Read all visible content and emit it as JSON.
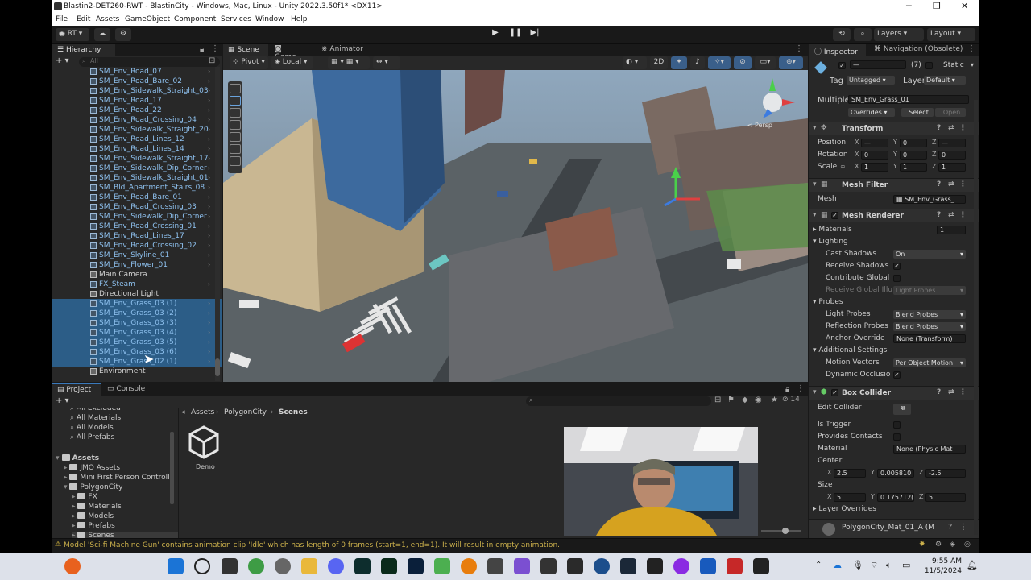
{
  "titlebar": {
    "title": "Blastin2-DET260-RWT - BlastinCity - Windows, Mac, Linux - Unity 2022.3.50f1* <DX11>"
  },
  "menu": [
    "File",
    "Edit",
    "Assets",
    "GameObject",
    "Component",
    "Services",
    "Window",
    "Help"
  ],
  "toolbar": {
    "account": "RT",
    "layers": "Layers",
    "layout": "Layout"
  },
  "hierarchy": {
    "tab": "Hierarchy",
    "search_placeholder": "All",
    "items": [
      {
        "label": "SM_Env_Road_07",
        "kind": "blue",
        "sel": false
      },
      {
        "label": "SM_Env_Road_Bare_02",
        "kind": "blue",
        "sel": false
      },
      {
        "label": "SM_Env_Sidewalk_Straight_03",
        "kind": "blue",
        "sel": false
      },
      {
        "label": "SM_Env_Road_17",
        "kind": "blue",
        "sel": false
      },
      {
        "label": "SM_Env_Road_22",
        "kind": "blue",
        "sel": false
      },
      {
        "label": "SM_Env_Road_Crossing_04",
        "kind": "blue",
        "sel": false
      },
      {
        "label": "SM_Env_Sidewalk_Straight_20",
        "kind": "blue",
        "sel": false
      },
      {
        "label": "SM_Env_Road_Lines_12",
        "kind": "blue",
        "sel": false
      },
      {
        "label": "SM_Env_Road_Lines_14",
        "kind": "blue",
        "sel": false
      },
      {
        "label": "SM_Env_Sidewalk_Straight_17",
        "kind": "blue",
        "sel": false
      },
      {
        "label": "SM_Env_Sidewalk_Dip_Corner",
        "kind": "blue",
        "sel": false
      },
      {
        "label": "SM_Env_Sidewalk_Straight_01",
        "kind": "blue",
        "sel": false
      },
      {
        "label": "SM_Bld_Apartment_Stairs_08",
        "kind": "blue",
        "sel": false
      },
      {
        "label": "SM_Env_Road_Bare_01",
        "kind": "blue",
        "sel": false
      },
      {
        "label": "SM_Env_Road_Crossing_03",
        "kind": "blue",
        "sel": false
      },
      {
        "label": "SM_Env_Sidewalk_Dip_Corner",
        "kind": "blue",
        "sel": false
      },
      {
        "label": "SM_Env_Road_Crossing_01",
        "kind": "blue",
        "sel": false
      },
      {
        "label": "SM_Env_Road_Lines_17",
        "kind": "blue",
        "sel": false
      },
      {
        "label": "SM_Env_Road_Crossing_02",
        "kind": "blue",
        "sel": false
      },
      {
        "label": "SM_Env_Skyline_01",
        "kind": "blue",
        "sel": false
      },
      {
        "label": "SM_Env_Flower_01",
        "kind": "blue",
        "sel": false
      },
      {
        "label": "Main Camera",
        "kind": "plain",
        "sel": false
      },
      {
        "label": "FX_Steam",
        "kind": "blue",
        "sel": false
      },
      {
        "label": "Directional Light",
        "kind": "plain",
        "sel": false
      },
      {
        "label": "SM_Env_Grass_03 (1)",
        "kind": "blue",
        "sel": true
      },
      {
        "label": "SM_Env_Grass_03 (2)",
        "kind": "blue",
        "sel": true
      },
      {
        "label": "SM_Env_Grass_03 (3)",
        "kind": "blue",
        "sel": true
      },
      {
        "label": "SM_Env_Grass_03 (4)",
        "kind": "blue",
        "sel": true
      },
      {
        "label": "SM_Env_Grass_03 (5)",
        "kind": "blue",
        "sel": true
      },
      {
        "label": "SM_Env_Grass_03 (6)",
        "kind": "blue",
        "sel": true
      },
      {
        "label": "SM_Env_Grass_02 (1)",
        "kind": "blue",
        "sel": true
      },
      {
        "label": "Environment",
        "kind": "plain",
        "sel": false
      }
    ]
  },
  "scene": {
    "tabs": [
      "Scene",
      "Game",
      "Animator"
    ],
    "pivot": "Pivot",
    "local": "Local",
    "mode_2d": "2D",
    "persp": "< Persp"
  },
  "inspector": {
    "tabs": [
      "Inspector",
      "Navigation (Obsolete)"
    ],
    "object_count": "(7)",
    "static": "Static",
    "tag_label": "Tag",
    "tag": "Untagged",
    "layer_label": "Layer",
    "layer": "Default",
    "multiple_label": "Multiple",
    "multiple_value": "SM_Env_Grass_01",
    "overrides": "Overrides",
    "select": "Select",
    "open": "Open",
    "transform": {
      "title": "Transform",
      "position": {
        "label": "Position",
        "x": "—",
        "y": "0",
        "z": "—"
      },
      "rotation": {
        "label": "Rotation",
        "x": "0",
        "y": "0",
        "z": "0"
      },
      "scale": {
        "label": "Scale",
        "x": "1",
        "y": "1",
        "z": "1"
      }
    },
    "mesh_filter": {
      "title": "Mesh Filter",
      "mesh_label": "Mesh",
      "mesh": "SM_Env_Grass_"
    },
    "mesh_renderer": {
      "title": "Mesh Renderer",
      "materials": "Materials",
      "materials_count": "1",
      "lighting": "Lighting",
      "cast_shadows": "Cast Shadows",
      "cast_shadows_val": "On",
      "receive_shadows": "Receive Shadows",
      "contribute_gi": "Contribute Global",
      "receive_gi": "Receive Global Illu",
      "receive_gi_val": "Light Probes",
      "probes": "Probes",
      "light_probes": "Light Probes",
      "light_probes_val": "Blend Probes",
      "reflection_probes": "Reflection Probes",
      "reflection_probes_val": "Blend Probes",
      "anchor_override": "Anchor Override",
      "anchor_override_val": "None (Transform)",
      "additional": "Additional Settings",
      "motion_vectors": "Motion Vectors",
      "motion_vectors_val": "Per Object Motion",
      "dynamic_occlusion": "Dynamic Occlusio"
    },
    "box_collider": {
      "title": "Box Collider",
      "edit_collider": "Edit Collider",
      "is_trigger": "Is Trigger",
      "provides_contacts": "Provides Contacts",
      "material": "Material",
      "material_val": "None (Physic Mat",
      "center": "Center",
      "center_x": "2.5",
      "center_y": "0.005810",
      "center_z": "-2.5",
      "size": "Size",
      "size_x": "5",
      "size_y": "0.175712(",
      "size_z": "5",
      "layer_overrides": "Layer Overrides"
    },
    "material_footer": "PolygonCity_Mat_01_A (M"
  },
  "project": {
    "tabs": [
      "Project",
      "Console"
    ],
    "count": "14",
    "favorites": [
      "All Excluded",
      "All Materials",
      "All Models",
      "All Prefabs"
    ],
    "tree": [
      {
        "label": "Assets",
        "indent": 0,
        "bold": true
      },
      {
        "label": "JMO Assets",
        "indent": 1
      },
      {
        "label": "Mini First Person Controlle",
        "indent": 1
      },
      {
        "label": "PolygonCity",
        "indent": 1
      },
      {
        "label": "FX",
        "indent": 2
      },
      {
        "label": "Materials",
        "indent": 2
      },
      {
        "label": "Models",
        "indent": 2
      },
      {
        "label": "Prefabs",
        "indent": 2
      },
      {
        "label": "Scenes",
        "indent": 2
      }
    ],
    "breadcrumb": [
      "Assets",
      "PolygonCity",
      "Scenes"
    ],
    "asset": "Demo"
  },
  "status": {
    "message": "Model 'Sci-fi Machine Gun' contains animation clip 'Idle' which has length of 0 frames (start=1, end=1). It will result in empty animation."
  },
  "taskbar": {
    "time": "9:55 AM",
    "date": "11/5/2024"
  }
}
